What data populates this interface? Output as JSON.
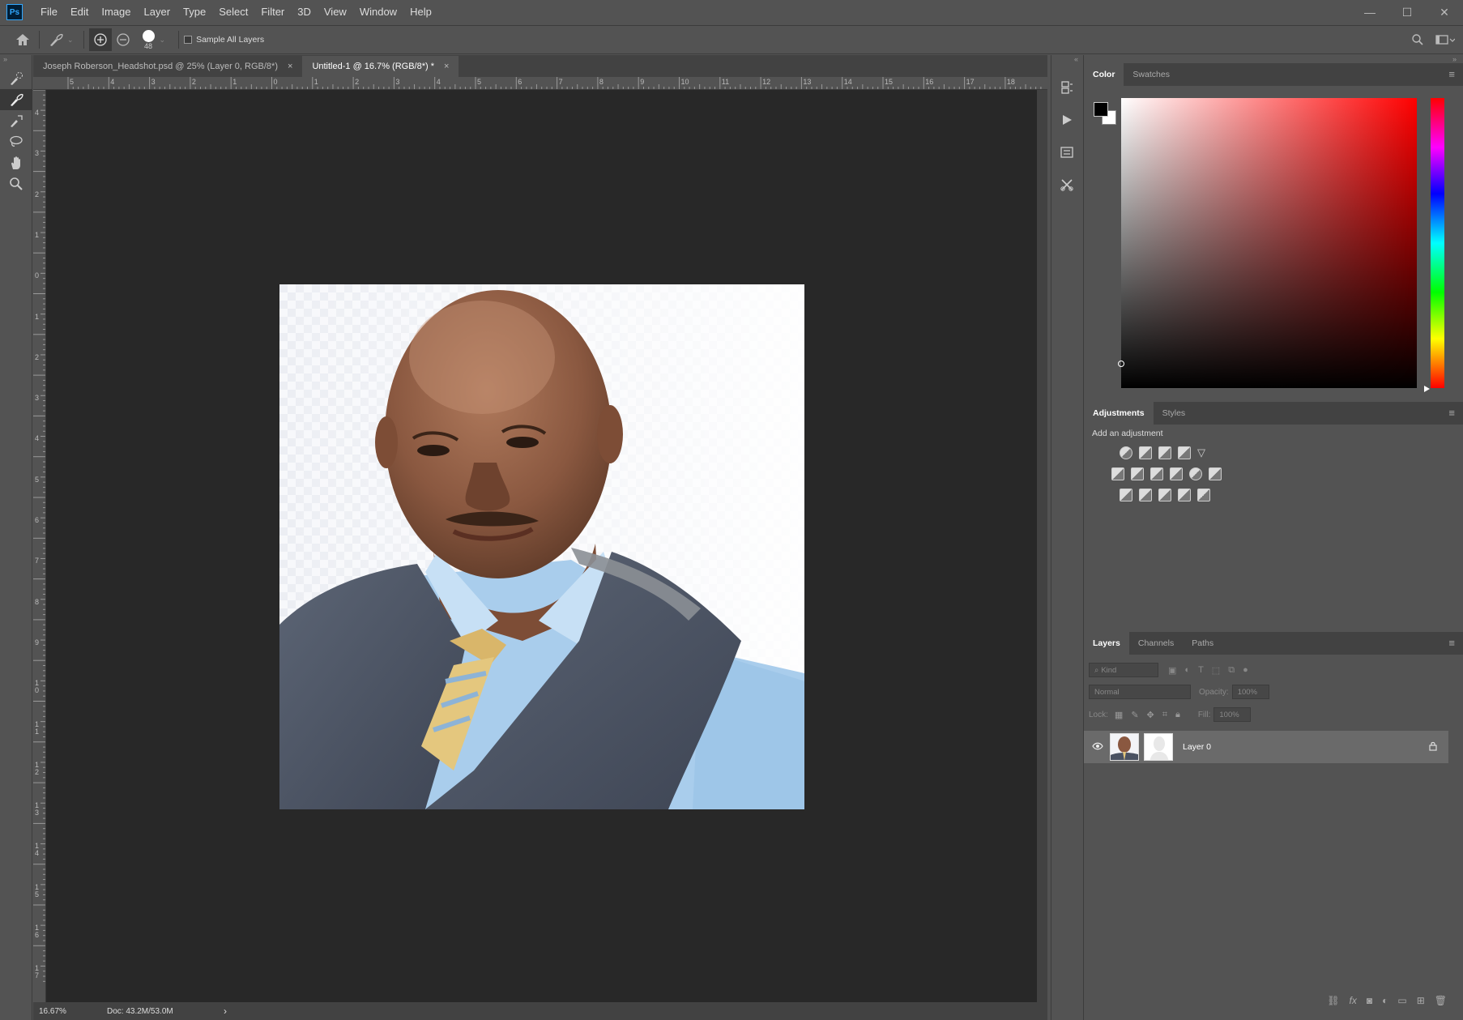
{
  "app": {
    "logo": "Ps"
  },
  "menu": [
    "File",
    "Edit",
    "Image",
    "Layer",
    "Type",
    "Select",
    "Filter",
    "3D",
    "View",
    "Window",
    "Help"
  ],
  "options": {
    "brush_size": "48",
    "sample_all_layers": "Sample All Layers"
  },
  "tabs": [
    {
      "label": "Joseph Roberson_Headshot.psd @ 25% (Layer 0, RGB/8*)",
      "close": "×",
      "active": false
    },
    {
      "label": "Untitled-1 @ 16.7% (RGB/8*) *",
      "close": "×",
      "active": true
    }
  ],
  "ruler": {
    "top": [
      "5",
      "4",
      "3",
      "2",
      "1",
      "0",
      "1",
      "2",
      "3",
      "4",
      "5",
      "6",
      "7",
      "8",
      "9",
      "10",
      "11",
      "12",
      "13",
      "14",
      "15",
      "16",
      "17",
      "18"
    ],
    "left": [
      "4",
      "3",
      "2",
      "1",
      "0",
      "1",
      "2",
      "3",
      "4",
      "5",
      "6",
      "7",
      "8",
      "9",
      "10",
      "11",
      "12",
      "13",
      "14",
      "15",
      "16",
      "17"
    ]
  },
  "status": {
    "zoom": "16.67%",
    "doc": "Doc: 43.2M/53.0M",
    "arrow": "›"
  },
  "color_panel": {
    "tabs": [
      "Color",
      "Swatches"
    ],
    "foreground": "#000000",
    "background": "#ffffff",
    "hue_accent": "#ff0000"
  },
  "adjustments_panel": {
    "tabs": [
      "Adjustments",
      "Styles"
    ],
    "prompt": "Add an adjustment"
  },
  "layers_panel": {
    "tabs": [
      "Layers",
      "Channels",
      "Paths"
    ],
    "filter_placeholder": "Kind",
    "blend_mode": "Normal",
    "opacity_label": "Opacity:",
    "opacity_value": "100%",
    "lock_label": "Lock:",
    "fill_label": "Fill:",
    "fill_value": "100%",
    "layers": [
      {
        "name": "Layer 0",
        "visible": true,
        "locked": true
      }
    ],
    "footer_icons": [
      "link-icon",
      "fx-icon",
      "mask-icon",
      "adjustment-icon",
      "folder-icon",
      "new-layer-icon",
      "trash-icon"
    ]
  }
}
